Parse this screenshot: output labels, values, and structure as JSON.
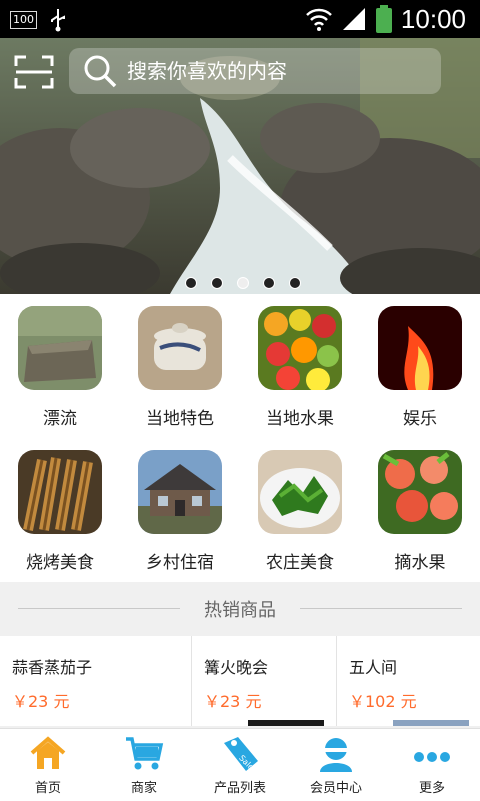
{
  "status": {
    "time": "10:00",
    "battery_label": "100"
  },
  "search": {
    "placeholder": "搜索你喜欢的内容"
  },
  "carousel": {
    "count": 5,
    "active_index": 2
  },
  "categories": [
    {
      "label": "漂流"
    },
    {
      "label": "当地特色"
    },
    {
      "label": "当地水果"
    },
    {
      "label": "娱乐"
    },
    {
      "label": "烧烤美食"
    },
    {
      "label": "乡村住宿"
    },
    {
      "label": "农庄美食"
    },
    {
      "label": "摘水果"
    }
  ],
  "hot": {
    "title": "热销商品"
  },
  "products": [
    {
      "name": "蒜香蒸茄子",
      "price": "￥23 元"
    },
    {
      "name": "篝火晚会",
      "price": "￥23 元"
    },
    {
      "name": "五人间",
      "price": "￥102 元"
    }
  ],
  "tabs": [
    {
      "label": "首页",
      "icon": "home-icon"
    },
    {
      "label": "商家",
      "icon": "cart-icon"
    },
    {
      "label": "产品列表",
      "icon": "sale-tag-icon"
    },
    {
      "label": "会员中心",
      "icon": "user-icon"
    },
    {
      "label": "更多",
      "icon": "more-icon"
    }
  ],
  "colors": {
    "accent": "#ff6b2c",
    "tab_icon": "#29a7e1",
    "home_icon": "#f5a623"
  }
}
